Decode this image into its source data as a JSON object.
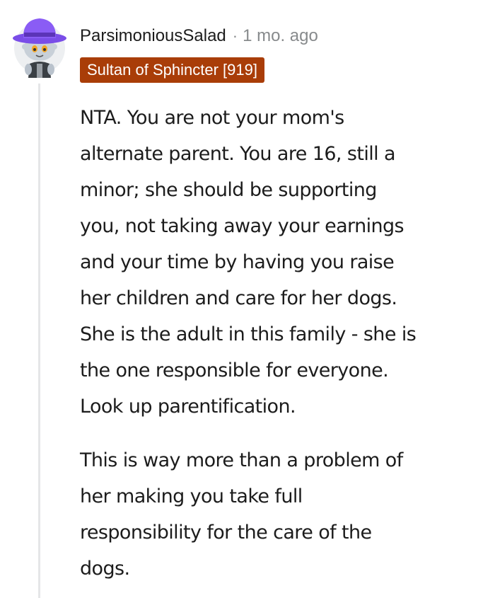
{
  "comment": {
    "avatar_icon": "snoo-avatar-purple-hat-icon",
    "author": "ParsimoniousSalad",
    "separator": "·",
    "timestamp": "1 mo. ago",
    "flair": {
      "text": "Sultan of Sphincter [919]",
      "background": "#a93d08",
      "color": "#ffffff"
    },
    "body": [
      {
        "lines": [
          "NTA. You are not your mom's",
          "alternate parent. You are 16, still a",
          "minor; she should be supporting",
          "you, not taking away your earnings",
          "and your time by having you raise",
          "her children and care for her dogs.",
          "She is the adult in this family - she is",
          "the one responsible for everyone.",
          "Look up parentification."
        ]
      },
      {
        "lines": [
          "This is way more than a problem of",
          "her making you take full",
          "responsibility for the care of the",
          "dogs."
        ]
      }
    ]
  },
  "colors": {
    "text": "#1c1c1c",
    "meta_gray": "#878a8c",
    "thread_line": "#e5e6e8",
    "hat_purple": "#8a5cf5"
  }
}
